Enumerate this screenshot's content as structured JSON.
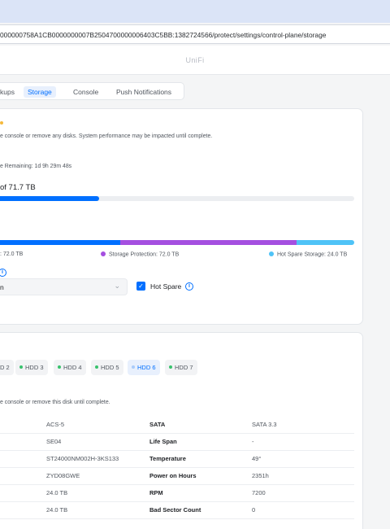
{
  "browser": {
    "url": "000000758A1CB0000000007B2504700000006403C5BB:1382724566/protect/settings/control-plane/storage"
  },
  "header": {
    "brand": "UniFi"
  },
  "tabs": [
    {
      "label": "kups",
      "active": false
    },
    {
      "label": "Storage",
      "active": true
    },
    {
      "label": "Console",
      "active": false
    },
    {
      "label": "Push Notifications",
      "active": false
    }
  ],
  "storage": {
    "warning": "e console or remove any disks. System performance may be impacted until complete.",
    "time_remaining": "e Remaining: 1d 9h 29m 48s",
    "capacity_text": "of 71.7 TB",
    "progress_fraction": 0.28,
    "allocation": [
      {
        "label": ": 72.0 TB",
        "color": "#006fff",
        "fraction": 0.34
      },
      {
        "label": "Storage Protection: 72.0 TB",
        "color": "#a54fe0",
        "fraction": 0.497
      },
      {
        "label": "Hot Spare Storage: 24.0 TB",
        "color": "#4fc3f7",
        "fraction": 0.163
      }
    ],
    "select_value": "n",
    "hot_spare_label": "Hot Spare",
    "hot_spare_checked": true
  },
  "disks": {
    "chips": [
      {
        "label": "D 2",
        "dot": false,
        "active": false
      },
      {
        "label": "HDD 3",
        "dot": true,
        "active": false
      },
      {
        "label": "HDD 4",
        "dot": true,
        "active": false
      },
      {
        "label": "HDD 5",
        "dot": true,
        "active": false
      },
      {
        "label": "HDD 6",
        "dot": true,
        "active": true
      },
      {
        "label": "HDD 7",
        "dot": true,
        "active": false
      }
    ],
    "note": "e console or remove this disk until complete.",
    "rows": [
      {
        "v1": "ACS-5",
        "k2": "SATA",
        "v2": "SATA 3.3"
      },
      {
        "v1": "SE04",
        "k2": "Life Span",
        "v2": "-"
      },
      {
        "v1": "ST24000NM002H-3KS133",
        "k2": "Temperature",
        "v2": "49°"
      },
      {
        "v1": "ZYD08GWE",
        "k2": "Power on Hours",
        "v2": "2351h"
      },
      {
        "v1": "24.0 TB",
        "k2": "RPM",
        "v2": "7200"
      },
      {
        "v1": "24.0 TB",
        "k2": "Bad Sector Count",
        "v2": "0"
      }
    ]
  }
}
